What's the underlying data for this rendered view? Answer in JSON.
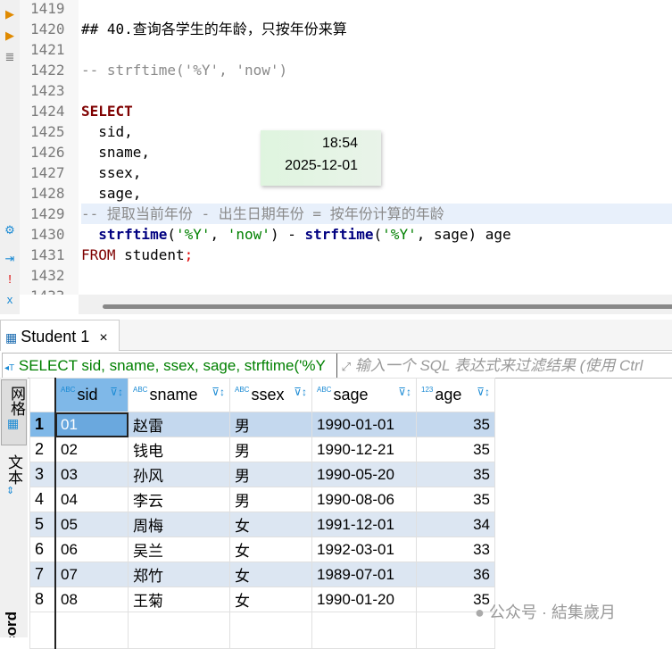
{
  "editor": {
    "lines": [
      {
        "n": "1419",
        "text": ""
      },
      {
        "n": "1420",
        "text": "## 40.查询各学生的年龄，只按年份来算"
      },
      {
        "n": "1421",
        "text": ""
      },
      {
        "n": "1422",
        "text": "-- strftime('%Y', 'now')"
      },
      {
        "n": "1423",
        "text": ""
      },
      {
        "n": "1424",
        "text": "SELECT"
      },
      {
        "n": "1425",
        "text": "  sid,"
      },
      {
        "n": "1426",
        "text": "  sname,"
      },
      {
        "n": "1427",
        "text": "  ssex,"
      },
      {
        "n": "1428",
        "text": "  sage,"
      },
      {
        "n": "1429",
        "text": "-- 提取当前年份 - 出生日期年份 = 按年份计算的年龄"
      },
      {
        "n": "1430",
        "a": "  strftime",
        "b": "(",
        "c": "'%Y'",
        "d": ", ",
        "e": "'now'",
        "f": ") - ",
        "g": "strftime",
        "h": "(",
        "i": "'%Y'",
        "j": ", sage) age"
      },
      {
        "n": "1431",
        "a": "FROM",
        "b": " student",
        "c": ";"
      },
      {
        "n": "1432",
        "text": ""
      },
      {
        "n": "1433",
        "text": ""
      }
    ]
  },
  "tooltip": {
    "time": "18:54",
    "date": "2025-12-01"
  },
  "results": {
    "tab_label": "Student 1",
    "close": "×",
    "query": "SELECT sid, sname, ssex, sage, strftime('%Y",
    "filter_placeholder": "输入一个 SQL 表达式来过滤结果 (使用 Ctrl",
    "side_tabs": {
      "grid": "网格",
      "text": "文本",
      "record": "Record"
    },
    "columns": [
      {
        "type": "ABC",
        "name": "sid"
      },
      {
        "type": "ABC",
        "name": "sname"
      },
      {
        "type": "ABC",
        "name": "ssex"
      },
      {
        "type": "ABC",
        "name": "sage"
      },
      {
        "type": "123",
        "name": "age"
      }
    ],
    "rows": [
      [
        "1",
        "01",
        "赵雷",
        "男",
        "1990-01-01",
        "35"
      ],
      [
        "2",
        "02",
        "钱电",
        "男",
        "1990-12-21",
        "35"
      ],
      [
        "3",
        "03",
        "孙风",
        "男",
        "1990-05-20",
        "35"
      ],
      [
        "4",
        "04",
        "李云",
        "男",
        "1990-08-06",
        "35"
      ],
      [
        "5",
        "05",
        "周梅",
        "女",
        "1991-12-01",
        "34"
      ],
      [
        "6",
        "06",
        "吴兰",
        "女",
        "1992-03-01",
        "33"
      ],
      [
        "7",
        "07",
        "郑竹",
        "女",
        "1989-07-01",
        "36"
      ],
      [
        "8",
        "08",
        "王菊",
        "女",
        "1990-01-20",
        "35"
      ]
    ]
  },
  "watermark": "公众号 · 結集歲月"
}
